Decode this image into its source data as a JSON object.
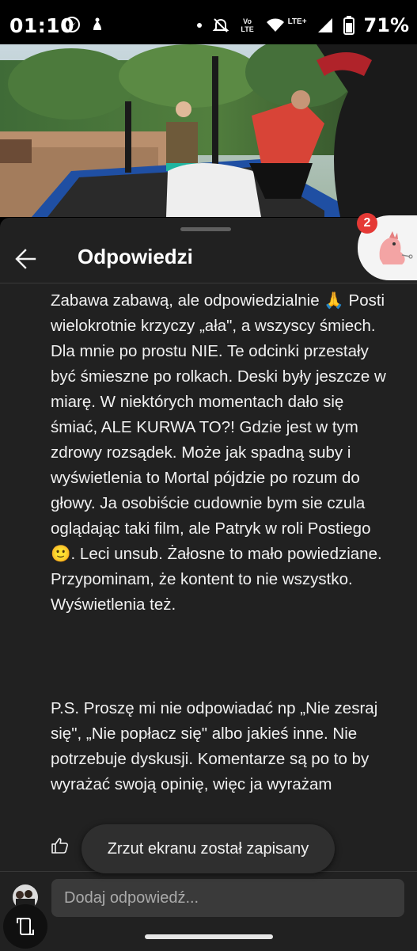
{
  "status_bar": {
    "time": "01:10",
    "battery": "71%",
    "network_label": "LTE+",
    "volte_label": "Vo LTE",
    "icons": [
      "messenger-icon",
      "shield-icon",
      "dot-icon",
      "mute-icon",
      "volte-icon",
      "wifi-icon",
      "signal-icon",
      "battery-icon"
    ]
  },
  "header": {
    "title": "Odpowiedzi",
    "back_icon": "arrow-left-icon"
  },
  "bubble": {
    "badge_count": "2",
    "icon": "dinosaur-avatar-icon"
  },
  "comment": {
    "body": "Zabawa zabawą, ale odpowiedzialnie 🙏 Posti wielokrotnie krzyczy „ała\", a wszyscy śmiech. Dla mnie po prostu NIE. Te odcinki przestały być śmieszne po rolkach. Deski były jeszcze w miarę. W niektórych momentach dało się śmiać, ALE KURWA TO?! Gdzie jest w tym zdrowy rozsądek. Może jak spadną suby i wyświetlenia to Mortal pójdzie po rozum do głowy. Ja osobiście cudownie bym sie czula oglądając taki film, ale Patryk w roli Postiego🙂. Leci unsub. Żałosne to mało powiedziane. Przypominam, że kontent to nie wszystko. Wyświetlenia też.",
    "ps": "P.S. Proszę mi nie odpowiadać np „Nie zesraj się\", „Nie popłacz się\" albo jakieś inne. Nie potrzebuje dyskusji. Komentarze są po to by wyrażać swoją opinię, więc ja wyrażam"
  },
  "toast": {
    "text": "Zrzut ekranu został zapisany"
  },
  "reply": {
    "placeholder": "Dodaj odpowiedź..."
  },
  "colors": {
    "sheet_bg": "#212121",
    "text": "#f1f1f1",
    "badge": "#e53935",
    "input_bg": "#3a3a3a"
  }
}
